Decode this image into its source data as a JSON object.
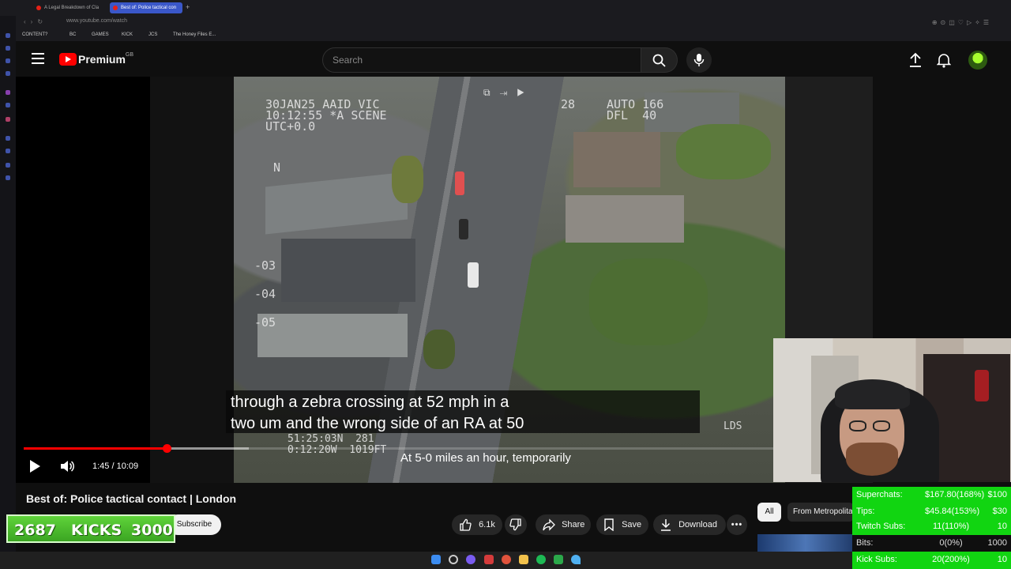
{
  "browser": {
    "tabs": [
      {
        "label": "A Legal Breakdown of Cla",
        "active": false
      },
      {
        "label": "Best of: Police tactical con",
        "active": true
      }
    ],
    "url": "www.youtube.com/watch",
    "bookmarks": [
      "CONTENT?",
      "BC",
      "GAMES",
      "KICK",
      "JCS",
      "The Honey Files E..."
    ]
  },
  "header": {
    "logo_text": "Premium",
    "logo_region": "GB",
    "search_placeholder": "Search"
  },
  "player": {
    "hud": {
      "top_left": "30JAN25 AAID VIC\n10:12:55 *A SCENE\nUTC+0.0",
      "top_mid": "28",
      "top_right": "AUTO 166\nDFL  40",
      "compass": "N",
      "scale_1": "-03",
      "scale_2": "-04",
      "scale_3": "-05",
      "bottom_left": "51:25:03N  281\n0:12:20W  1019FT",
      "bottom_right": "LDS"
    },
    "caption_line_1": "through a zebra crossing at 52 mph in a",
    "caption_line_2": "two um and the wrong side of an RA at 50",
    "burned_subtitle": "At 5-0 miles an hour, temporarily",
    "current_time": "1:45",
    "duration": "10:09",
    "time_display": "1:45 / 10:09",
    "progress_fraction": 0.172,
    "buffer_fraction": 0.27
  },
  "video": {
    "title": "Best of: Police tactical contact | London",
    "subscribe_label": "Subscribe",
    "like_count": "6.1k",
    "share_label": "Share",
    "save_label": "Save",
    "download_label": "Download"
  },
  "chips": {
    "all": "All",
    "from": "From Metropolitan"
  },
  "kicks_overlay": {
    "current": "2687",
    "label": "KICKS",
    "goal": "3000"
  },
  "goals_overlay": [
    {
      "label": "Superchats:",
      "value": "$167.80(168%)",
      "target": "$100"
    },
    {
      "label": "Tips:",
      "value": "$45.84(153%)",
      "target": "$30"
    },
    {
      "label": "Twitch Subs:",
      "value": "11(110%)",
      "target": "10"
    },
    {
      "label": "Bits:",
      "value": "0(0%)",
      "target": "1000"
    },
    {
      "label": "Kick Subs:",
      "value": "20(200%)",
      "target": "10"
    }
  ],
  "colors": {
    "youtube_red": "#ff0000",
    "goals_green": "#11d511",
    "kicks_green": "#4cbd2c",
    "active_tab": "#3a57c9"
  }
}
